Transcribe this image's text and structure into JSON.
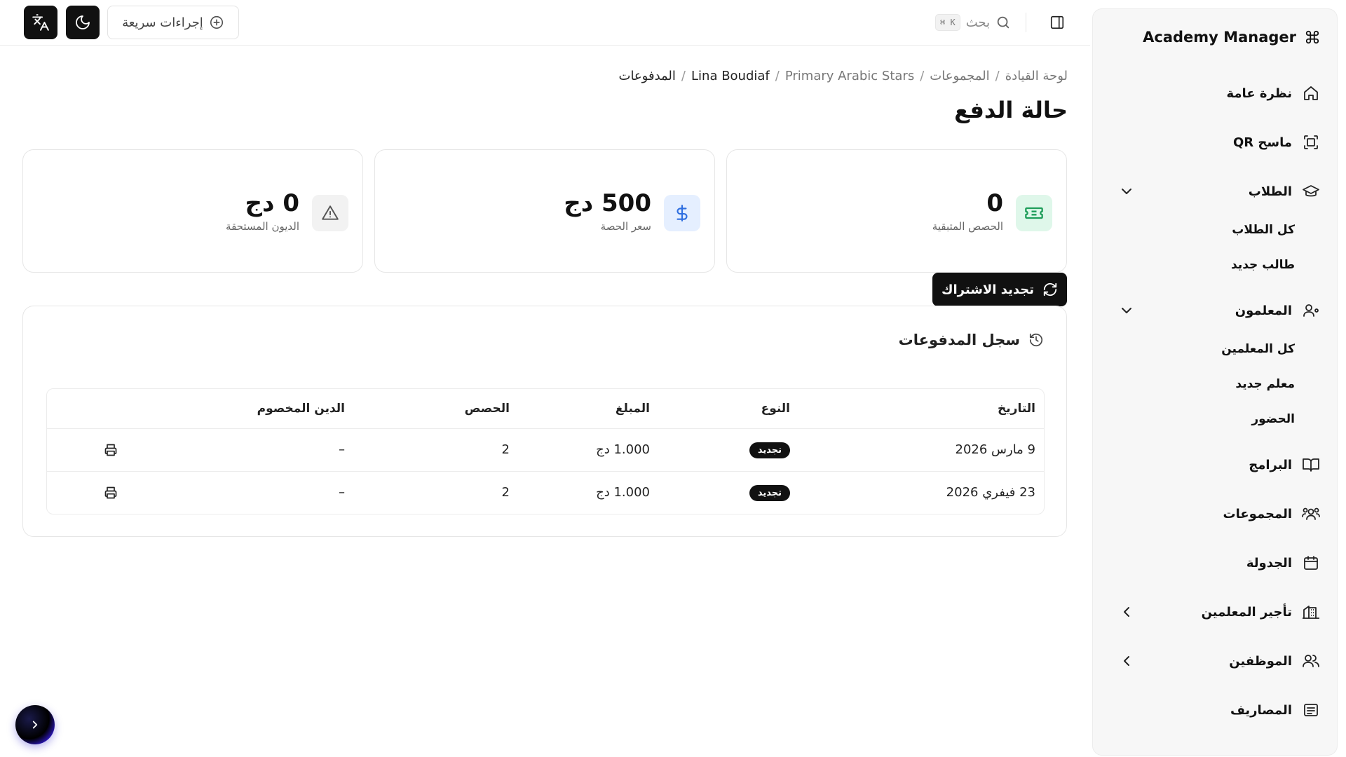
{
  "app": {
    "name": "Academy Manager"
  },
  "topbar": {
    "quick_actions_label": "إجراءات سريعة",
    "search_label": "بحث",
    "search_shortcut": "⌘ K"
  },
  "sidebar": {
    "items": [
      {
        "label": "نظرة عامة",
        "icon": "home-icon"
      },
      {
        "label": "ماسح QR",
        "icon": "scan-icon"
      },
      {
        "label": "الطلاب",
        "icon": "graduation-cap-icon",
        "expanded": true,
        "children": [
          {
            "label": "كل الطلاب"
          },
          {
            "label": "طالب جديد"
          }
        ]
      },
      {
        "label": "المعلمون",
        "icon": "user-cog-icon",
        "expanded": true,
        "children": [
          {
            "label": "كل المعلمين"
          },
          {
            "label": "معلم جديد"
          },
          {
            "label": "الحضور"
          }
        ]
      },
      {
        "label": "البرامج",
        "icon": "book-open-icon"
      },
      {
        "label": "المجموعات",
        "icon": "users-group-icon"
      },
      {
        "label": "الجدولة",
        "icon": "calendar-icon"
      },
      {
        "label": "تأجير المعلمين",
        "icon": "building-icon",
        "expanded": false
      },
      {
        "label": "الموظفين",
        "icon": "users-icon",
        "expanded": false
      },
      {
        "label": "المصاريف",
        "icon": "receipt-icon"
      }
    ]
  },
  "breadcrumb": {
    "items": [
      "لوحة القيادة",
      "المجموعات",
      "Primary Arabic Stars",
      "Lina Boudiaf",
      "المدفوعات"
    ],
    "separator": "/"
  },
  "page": {
    "title": "حالة الدفع"
  },
  "stats": [
    {
      "value": "0",
      "label": "الحصص المتبقية",
      "icon": "ticket-icon",
      "icon_bg": "#dff7ea",
      "icon_color": "#1f9d5a"
    },
    {
      "value": "500 دج",
      "label": "سعر الحصة",
      "icon": "dollar-icon",
      "icon_bg": "#e5efff",
      "icon_color": "#2f6fe0"
    },
    {
      "value": "0 دج",
      "label": "الديون المستحقة",
      "icon": "alert-triangle-icon",
      "icon_bg": "#f2f2f2",
      "icon_color": "#555"
    }
  ],
  "actions": {
    "renew_label": "تجديد الاشتراك"
  },
  "history": {
    "title": "سجل المدفوعات",
    "columns": [
      "التاريخ",
      "النوع",
      "المبلغ",
      "الحصص",
      "الدين المخصوم",
      ""
    ],
    "rows": [
      {
        "date": "9 مارس 2026",
        "type": "تجديد",
        "amount": "1.000 دج",
        "sessions": "2",
        "debt": "–"
      },
      {
        "date": "23 فيفري 2026",
        "type": "تجديد",
        "amount": "1.000 دج",
        "sessions": "2",
        "debt": "–"
      }
    ]
  },
  "colors": {
    "accent": "#111111",
    "border": "#e6e6e6",
    "sidebar_bg": "#f7f7f7"
  }
}
